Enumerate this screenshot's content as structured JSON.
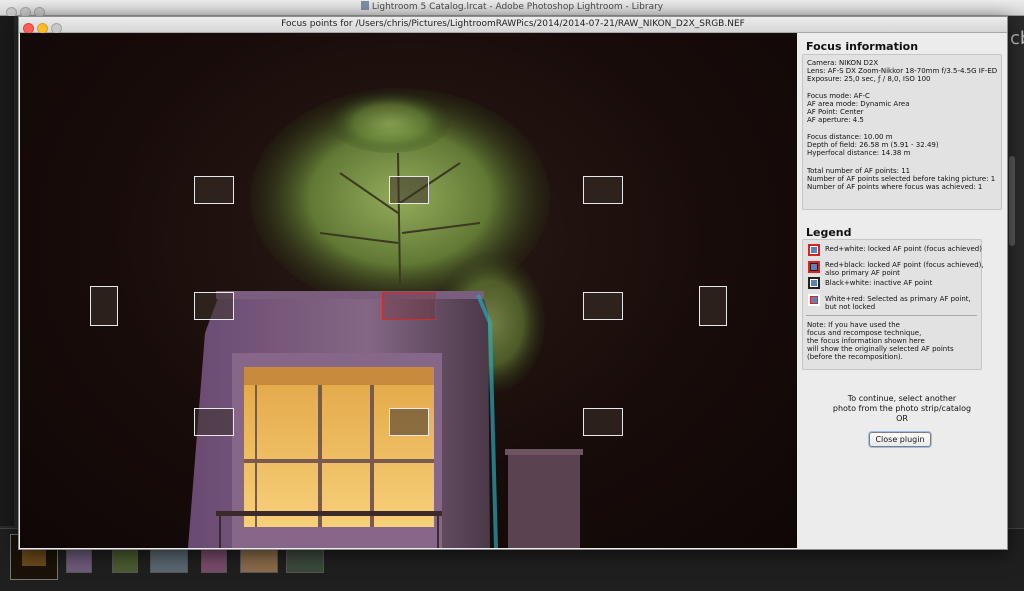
{
  "app_window": {
    "title": "Lightroom 5 Catalog.lrcat - Adobe Photoshop Lightroom - Library"
  },
  "dialog": {
    "title": "Focus points for /Users/chris/Pictures/LightroomRAWPics/2014/2014-07-21/RAW_NIKON_D2X_SRGB.NEF"
  },
  "focus_information": {
    "heading": "Focus information",
    "camera": "Camera: NIKON D2X",
    "lens": "Lens: AF-S DX Zoom-Nikkor 18-70mm f/3.5-4.5G IF-ED",
    "exposure": "Exposure: 25,0 sec, ƒ / 8,0, ISO 100",
    "focus_mode": "Focus mode: AF-C",
    "af_area_mode": "AF area mode: Dynamic Area",
    "af_point": "AF Point: Center",
    "af_aperture": "AF aperture: 4.5",
    "focus_distance": "Focus distance: 10.00 m",
    "depth_of_field": "Depth of field: 26.58 m (5.91 - 32.49)",
    "hyperfocal_distance": "Hyperfocal distance: 14.38 m",
    "total_af_points": "Total number of AF points: 11",
    "af_points_selected": "Number of AF points selected before taking picture: 1",
    "af_points_focus": "Number of AF points where focus was achieved: 1"
  },
  "legend": {
    "heading": "Legend",
    "items": [
      {
        "swatch": "red-white",
        "lines": [
          "Red+white: locked AF point (focus achieved)"
        ]
      },
      {
        "swatch": "red-black",
        "lines": [
          "Red+black: locked AF point (focus achieved),",
          "also primary AF point"
        ]
      },
      {
        "swatch": "black-white",
        "lines": [
          "Black+white: inactive AF point"
        ]
      },
      {
        "swatch": "white-red",
        "lines": [
          "White+red: Selected as primary AF point,",
          "but not locked"
        ]
      }
    ],
    "note": [
      "Note: If you have used the",
      "focus and recompose technique,",
      "the focus information shown here",
      "will show the originally selected AF points",
      "(before the recomposition)."
    ]
  },
  "continue_text": [
    "To continue, select another",
    "photo from the photo strip/catalog",
    "OR"
  ],
  "close_button": "Close plugin",
  "background_char": "cb",
  "af_points": [
    {
      "id": "top-left",
      "state": "inactive"
    },
    {
      "id": "top-center",
      "state": "inactive"
    },
    {
      "id": "top-right",
      "state": "inactive"
    },
    {
      "id": "far-left",
      "state": "inactive"
    },
    {
      "id": "mid-left",
      "state": "inactive"
    },
    {
      "id": "center",
      "state": "locked-primary"
    },
    {
      "id": "mid-right",
      "state": "inactive"
    },
    {
      "id": "far-right",
      "state": "inactive"
    },
    {
      "id": "bottom-left",
      "state": "inactive"
    },
    {
      "id": "bottom-center",
      "state": "inactive"
    },
    {
      "id": "bottom-right",
      "state": "inactive"
    }
  ],
  "colors": {
    "af_active": "#d42a2a",
    "af_inactive_border": "#e8e8e8",
    "swatch_blue": "#5d82b5"
  }
}
